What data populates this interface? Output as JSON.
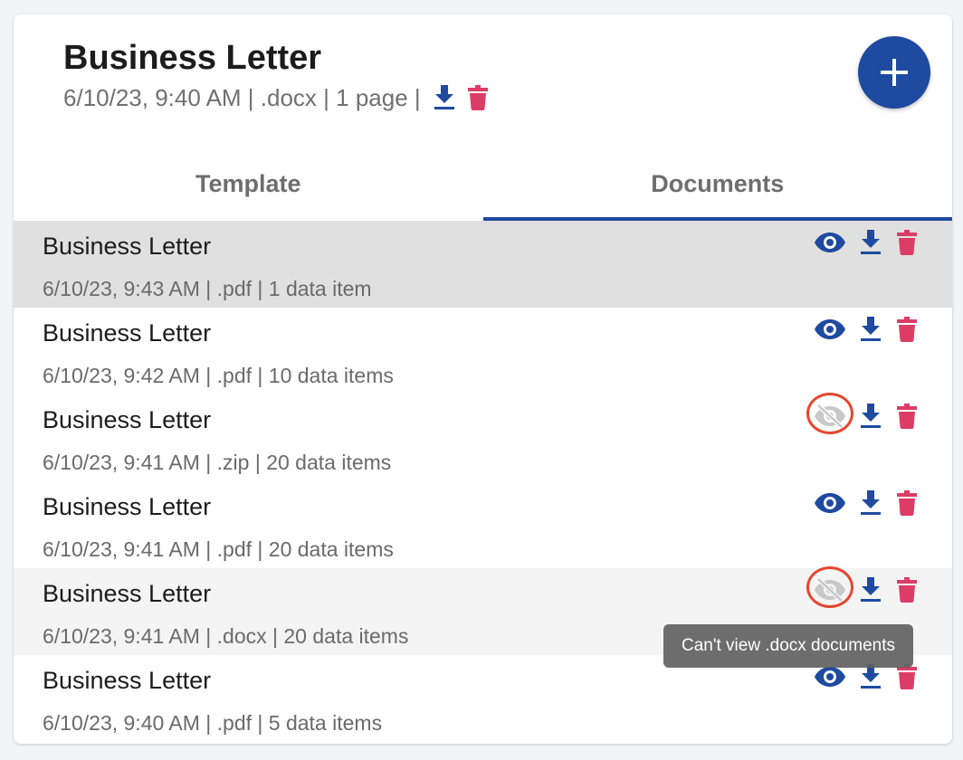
{
  "header": {
    "title": "Business Letter",
    "meta": "6/10/23, 9:40 AM | .docx | 1 page |",
    "download_icon": "download-icon",
    "delete_icon": "trash-icon"
  },
  "fab": {
    "icon": "plus-icon"
  },
  "tabs": [
    {
      "label": "Template",
      "active": false
    },
    {
      "label": "Documents",
      "active": true
    }
  ],
  "documents": [
    {
      "name": "Business Letter",
      "meta": "6/10/23, 9:43 AM | .pdf | 1 data item",
      "viewable": true
    },
    {
      "name": "Business Letter",
      "meta": "6/10/23, 9:42 AM | .pdf | 10 data items",
      "viewable": true
    },
    {
      "name": "Business Letter",
      "meta": "6/10/23, 9:41 AM | .zip | 20 data items",
      "viewable": false
    },
    {
      "name": "Business Letter",
      "meta": "6/10/23, 9:41 AM | .pdf | 20 data items",
      "viewable": true
    },
    {
      "name": "Business Letter",
      "meta": "6/10/23, 9:41 AM | .docx | 20 data items",
      "viewable": false
    },
    {
      "name": "Business Letter",
      "meta": "6/10/23, 9:40 AM | .pdf | 5 data items",
      "viewable": true
    }
  ],
  "tooltip": {
    "text": "Can't view .docx documents"
  },
  "colors": {
    "accent": "#1e4aa0",
    "delete": "#dc3d66",
    "disabled": "#c8c8c8",
    "highlight_ring": "#e5462f",
    "selected_row": "#e0e0e0",
    "hovered_row": "#f4f4f4"
  }
}
